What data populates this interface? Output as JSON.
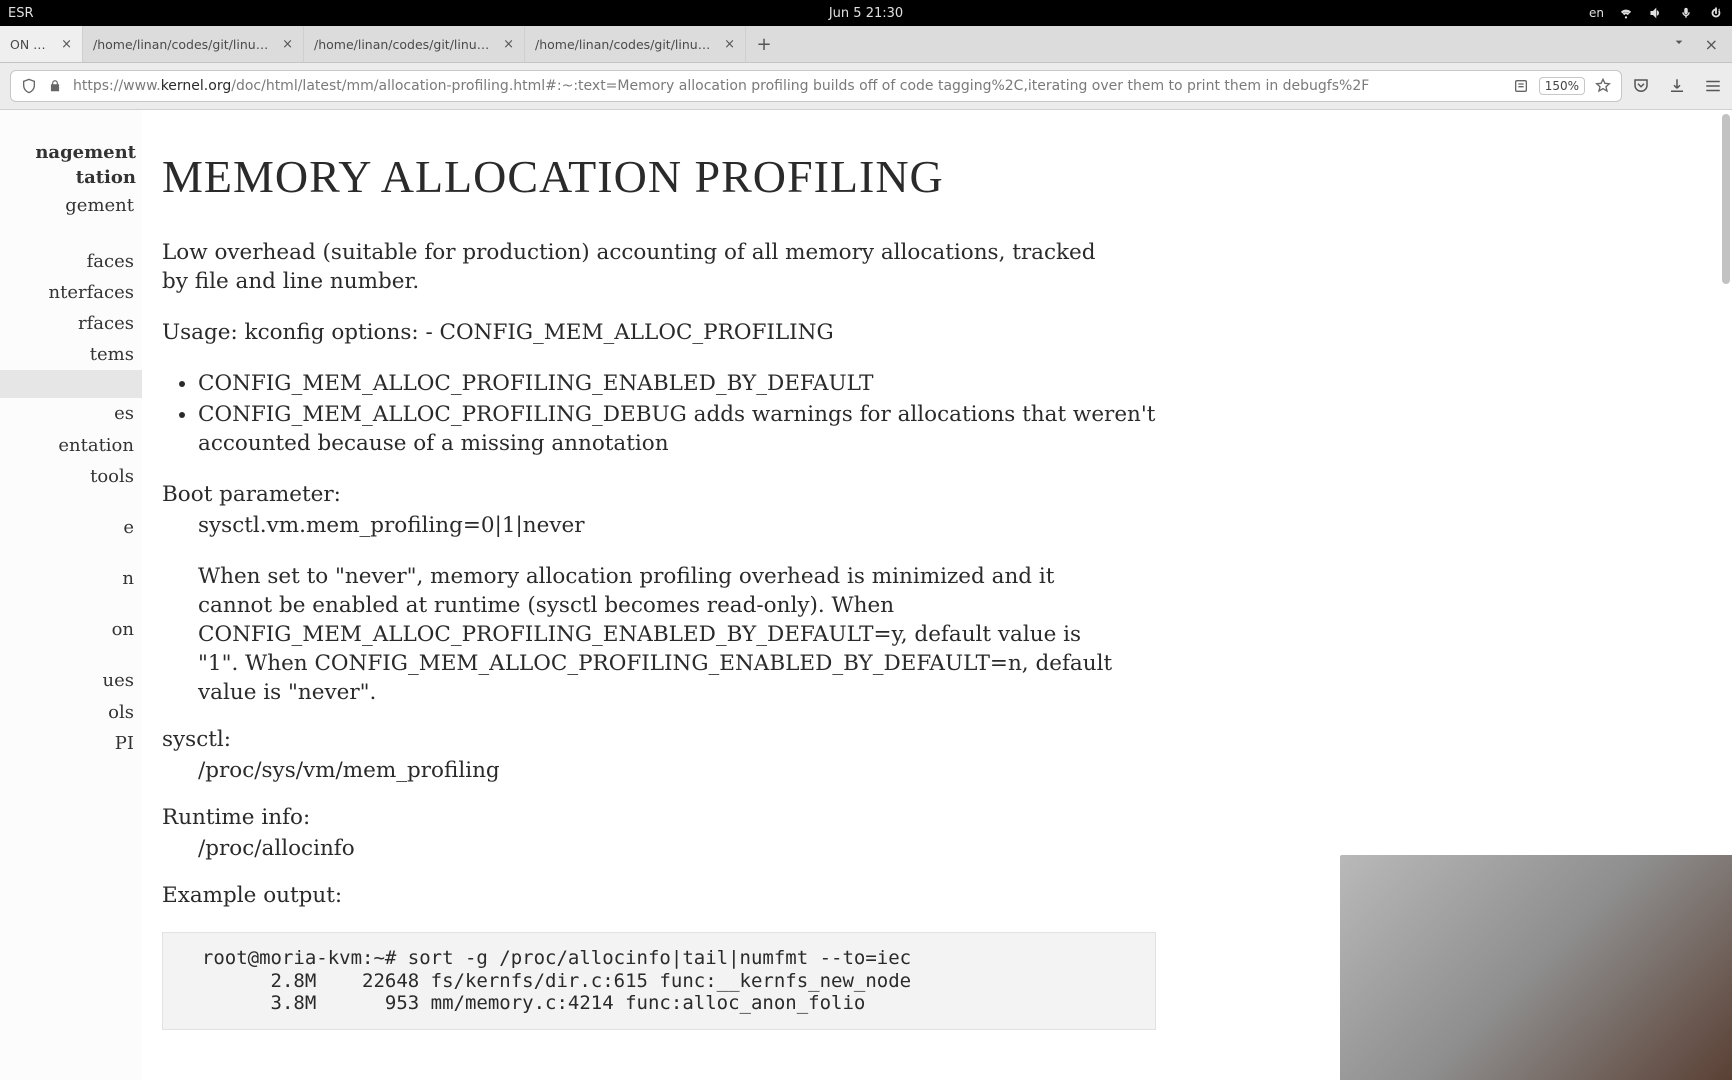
{
  "topbar": {
    "left": "ESR",
    "center": "Jun 5  21:30",
    "lang": "en"
  },
  "tabs": [
    {
      "title": "ON PRO…",
      "active": true
    },
    {
      "title": "/home/linan/codes/git/linux…",
      "active": false
    },
    {
      "title": "/home/linan/codes/git/linux…",
      "active": false
    },
    {
      "title": "/home/linan/codes/git/linux…",
      "active": false
    }
  ],
  "url": {
    "prefix": "https://www.",
    "domain": "kernel.org",
    "rest": "/doc/html/latest/mm/allocation-profiling.html#:~:text=Memory allocation profiling builds off of code tagging%2C,iterating over them to print them in debugfs%2F",
    "zoom": "150%"
  },
  "sidebar": {
    "heading1": "nagement",
    "heading2": "tation",
    "items": [
      {
        "label": "gement",
        "active": false
      },
      {
        "label": "",
        "active": false
      },
      {
        "label": "faces",
        "active": false
      },
      {
        "label": "nterfaces",
        "active": false
      },
      {
        "label": "rfaces",
        "active": false
      },
      {
        "label": "tems",
        "active": false
      },
      {
        "label": "",
        "active": true
      },
      {
        "label": "es",
        "active": false
      },
      {
        "label": "entation",
        "active": false
      },
      {
        "label": " tools",
        "active": false
      },
      {
        "label": "",
        "active": false
      },
      {
        "label": "e",
        "active": false
      },
      {
        "label": "",
        "active": false
      },
      {
        "label": "n",
        "active": false
      },
      {
        "label": "",
        "active": false
      },
      {
        "label": "on",
        "active": false
      },
      {
        "label": "",
        "active": false
      },
      {
        "label": "ues",
        "active": false
      },
      {
        "label": "ols",
        "active": false
      },
      {
        "label": "PI",
        "active": false
      }
    ]
  },
  "page": {
    "title": "MEMORY ALLOCATION PROFILING",
    "para_intro": "Low overhead (suitable for production) accounting of all memory allocations, tracked by file and line number.",
    "para_usage": "Usage: kconfig options: - CONFIG_MEM_ALLOC_PROFILING",
    "kconfig_items": [
      "CONFIG_MEM_ALLOC_PROFILING_ENABLED_BY_DEFAULT",
      "CONFIG_MEM_ALLOC_PROFILING_DEBUG adds warnings for allocations that weren't accounted because of a missing annotation"
    ],
    "boot_dt": "Boot parameter:",
    "boot_sysctl": "sysctl.vm.mem_profiling=0|1|never",
    "boot_expl": "When set to \"never\", memory allocation profiling overhead is minimized and it cannot be enabled at runtime (sysctl becomes read-only). When CONFIG_MEM_ALLOC_PROFILING_ENABLED_BY_DEFAULT=y, default value is \"1\". When CONFIG_MEM_ALLOC_PROFILING_ENABLED_BY_DEFAULT=n, default value is \"never\".",
    "sysctl_dt": "sysctl:",
    "sysctl_dd": "/proc/sys/vm/mem_profiling",
    "runtime_dt": "Runtime info:",
    "runtime_dd": "/proc/allocinfo",
    "example_dt": "Example output:",
    "code": "  root@moria-kvm:~# sort -g /proc/allocinfo|tail|numfmt --to=iec\n        2.8M    22648 fs/kernfs/dir.c:615 func:__kernfs_new_node\n        3.8M      953 mm/memory.c:4214 func:alloc_anon_folio"
  }
}
